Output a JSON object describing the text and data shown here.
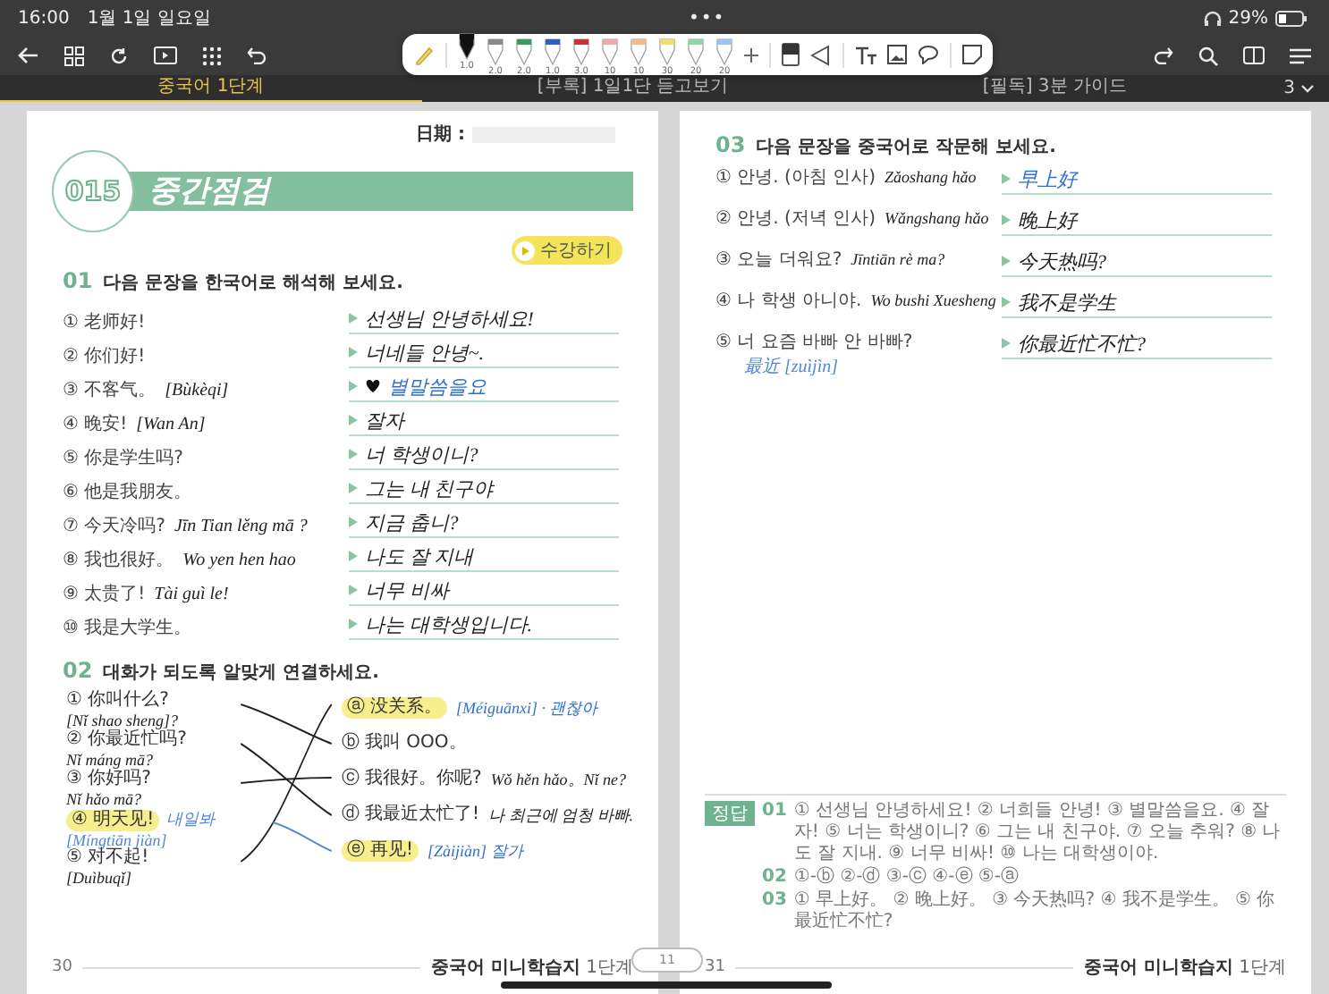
{
  "status_bar": {
    "time": "16:00",
    "date": "1월 1일 일요일",
    "dots": "•••",
    "battery": "29%"
  },
  "tabs": [
    {
      "label": "중국어 1단계",
      "selected": true
    },
    {
      "label": "[부록] 1일1단 듣고보기",
      "selected": false
    },
    {
      "label": "[필독] 3분 가이드",
      "selected": false
    }
  ],
  "tab_count": "3",
  "pen_toolbar": {
    "pens": [
      {
        "size": "1.0",
        "color": "#111111",
        "selected": true
      },
      {
        "size": "2.0",
        "color": "#8a8a8a",
        "selected": false
      },
      {
        "size": "2.0",
        "color": "#3c9a5a",
        "selected": false
      },
      {
        "size": "1.0",
        "color": "#2f5fc4",
        "selected": false
      },
      {
        "size": "3.0",
        "color": "#c8333a",
        "selected": false
      },
      {
        "size": "10",
        "color": "#f2a7b0",
        "selected": false
      },
      {
        "size": "10",
        "color": "#f5b98a",
        "selected": false
      },
      {
        "size": "30",
        "color": "#f2dc6a",
        "selected": false
      },
      {
        "size": "20",
        "color": "#8fd6a0",
        "selected": false
      },
      {
        "size": "20",
        "color": "#9cc4ee",
        "selected": false
      }
    ]
  },
  "left_page": {
    "date_label": "日期 :",
    "lesson_number": "015",
    "title": "중간점검",
    "play_button": "수강하기",
    "section_1": {
      "number": "01",
      "instruction": "다음 문장을 한국어로 해석해 보세요.",
      "items": [
        {
          "marker": "①",
          "text": "老师好!",
          "answer": "선생님 안녕하세요!",
          "color": "#222222"
        },
        {
          "marker": "②",
          "text": "你们好!",
          "answer": "너네들 안녕~.",
          "color": "#222222"
        },
        {
          "marker": "③",
          "text": "不客气。",
          "note": "[Bùkèqi]",
          "answer": "별말씀을요",
          "color": "#2f6fd6",
          "scribble": true
        },
        {
          "marker": "④",
          "text": "晚安!",
          "note": "[Wan An]",
          "answer": "잘자",
          "color": "#222222"
        },
        {
          "marker": "⑤",
          "text": "你是学生吗?",
          "answer": "너 학생이니?",
          "color": "#222222"
        },
        {
          "marker": "⑥",
          "text": "他是我朋友。",
          "answer": "그는 내 친구야",
          "color": "#222222"
        },
        {
          "marker": "⑦",
          "text": "今天冷吗?",
          "note": "Jīn Tian lěng mā ?",
          "answer": "지금 춥니?",
          "color": "#222222"
        },
        {
          "marker": "⑧",
          "text": "我也很好。",
          "note": "Wo yen hen hao",
          "answer": "나도 잘 지내",
          "color": "#222222"
        },
        {
          "marker": "⑨",
          "text": "太贵了!",
          "note": "Tài guì le!",
          "answer": "너무 비싸",
          "color": "#222222"
        },
        {
          "marker": "⑩",
          "text": "我是大学生。",
          "answer": "나는 대학생입니다.",
          "color": "#222222"
        }
      ]
    },
    "section_2": {
      "number": "02",
      "instruction": "대화가 되도록 알맞게 연결하세요.",
      "left_items": [
        {
          "marker": "①",
          "text": "你叫什么?",
          "note": "[Nǐ shao sheng]?",
          "highlighted": false
        },
        {
          "marker": "②",
          "text": "你最近忙吗?",
          "note": "Nǐ máng mā?",
          "highlighted": false
        },
        {
          "marker": "③",
          "text": "你好吗?",
          "note": "Nǐ hǎo mā?",
          "highlighted": false
        },
        {
          "marker": "④",
          "text": "明天见!",
          "note": "[Míngtiān jiàn]",
          "side_note": "내일봐",
          "highlighted": true
        },
        {
          "marker": "⑤",
          "text": "对不起!",
          "note": "[Duìbuqǐ]",
          "highlighted": false
        }
      ],
      "right_items": [
        {
          "marker": "ⓐ",
          "text": "没关系。",
          "note": "[Méiguānxi] · 괜찮아",
          "highlighted": true,
          "color": "#2f6fd6"
        },
        {
          "marker": "ⓑ",
          "text": "我叫 OOO。",
          "highlighted": false
        },
        {
          "marker": "ⓒ",
          "text": "我很好。你呢?",
          "note": "Wǒ hěn hǎo。Nǐ ne?",
          "highlighted": false,
          "color": "#222222"
        },
        {
          "marker": "ⓓ",
          "text": "我最近太忙了!",
          "note": "나 최근에 엄청 바빠.",
          "highlighted": false,
          "color": "#222222"
        },
        {
          "marker": "ⓔ",
          "text": "再见!",
          "note": "[Zàijiàn] 잘가",
          "highlighted": true,
          "color": "#2f6fd6"
        }
      ]
    },
    "page_number": "30",
    "footer": "**중국어 미니학습지** 1단계"
  },
  "right_page": {
    "section_3": {
      "number": "03",
      "instruction": "다음 문장을 중국어로 작문해 보세요.",
      "items": [
        {
          "marker": "①",
          "text": "안녕. (아침 인사)",
          "note": "Zǎoshang hǎo",
          "answer": "早上好",
          "color": "#2f6fd6"
        },
        {
          "marker": "②",
          "text": "안녕. (저녁 인사)",
          "note": "Wǎngshang hǎo",
          "answer": "晚上好",
          "color": "#222222"
        },
        {
          "marker": "③",
          "text": "오늘 더워요?",
          "note": "Jīntiān rè ma?",
          "answer": "今天热吗?",
          "color": "#222222"
        },
        {
          "marker": "④",
          "text": "나 학생 아니야.",
          "note": "Wo bushi Xuesheng",
          "answer": "我不是学生",
          "color": "#222222"
        },
        {
          "marker": "⑤",
          "text": "너 요즘 바빠 안 바빠?",
          "below_note": "最近 [zuìjìn]",
          "answer": "你最近忙不忙?",
          "color": "#222222"
        }
      ]
    },
    "answer_key": {
      "label": "정답",
      "lines": [
        {
          "number": "01",
          "text": "① 선생님 안녕하세요! ② 너희들 안녕! ③ 별말씀을요. ④ 잘 자! ⑤ 너는 학생이니? ⑥ 그는 내 친구야. ⑦ 오늘 추워? ⑧ 나도 잘 지내. ⑨ 너무 비싸! ⑩ 나는 대학생이야."
        },
        {
          "number": "02",
          "text": "①-ⓑ ②-ⓓ ③-ⓒ ④-ⓔ ⑤-ⓐ"
        },
        {
          "number": "03",
          "text": "① 早上好。 ② 晚上好。 ③ 今天热吗? ④ 我不是学生。 ⑤ 你最近忙不忙?"
        }
      ]
    },
    "page_number": "31",
    "footer": "**중국어 미니학습지** 1단계"
  },
  "page_scrubber": "11"
}
